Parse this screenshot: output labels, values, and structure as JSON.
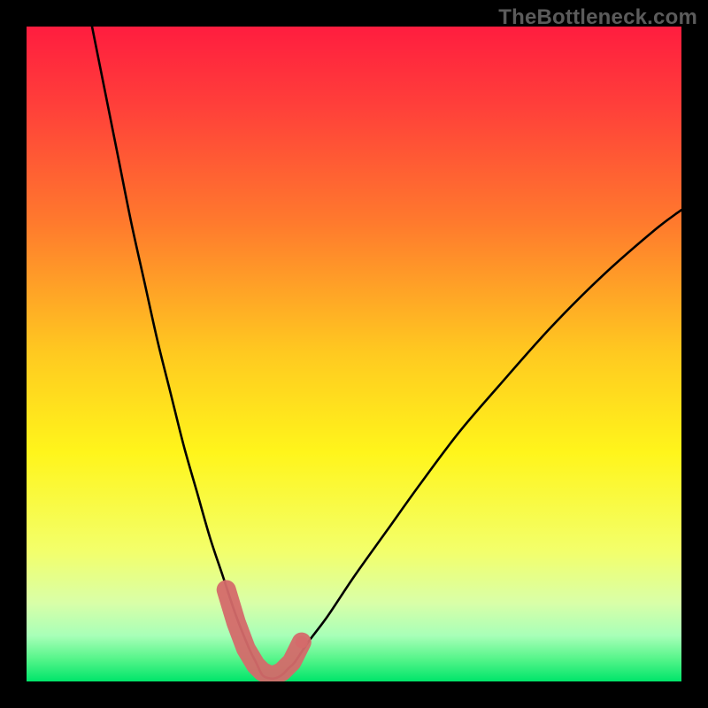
{
  "meta": {
    "watermark": "TheBottleneck.com"
  },
  "chart_data": {
    "type": "line",
    "title": "",
    "xlabel": "",
    "ylabel": "",
    "xlim": [
      0,
      100
    ],
    "ylim": [
      0,
      100
    ],
    "grid": false,
    "legend": null,
    "description": "Bottleneck % vs component balance. V-shaped curve on a red→green vertical heat gradient; minimum (~0%) occurs near x≈36.",
    "gradient_stops": [
      {
        "pos": 0.0,
        "color": "#ff1d3f"
      },
      {
        "pos": 0.12,
        "color": "#ff3f3a"
      },
      {
        "pos": 0.3,
        "color": "#ff7a2d"
      },
      {
        "pos": 0.5,
        "color": "#ffca20"
      },
      {
        "pos": 0.65,
        "color": "#fff51b"
      },
      {
        "pos": 0.8,
        "color": "#f3ff6a"
      },
      {
        "pos": 0.88,
        "color": "#d9ffa8"
      },
      {
        "pos": 0.93,
        "color": "#a8ffb8"
      },
      {
        "pos": 0.965,
        "color": "#57f58b"
      },
      {
        "pos": 1.0,
        "color": "#00e56a"
      }
    ],
    "series": [
      {
        "name": "bottleneck-curve",
        "color": "#000000",
        "x": [
          10,
          12,
          14,
          16,
          18,
          20,
          22,
          24,
          26,
          28,
          30,
          32,
          34,
          35,
          36,
          37,
          38,
          39,
          40,
          41,
          43,
          46,
          50,
          55,
          60,
          66,
          72,
          80,
          88,
          96,
          100
        ],
        "values": [
          100,
          90,
          80,
          70,
          61,
          52,
          44,
          36,
          29,
          22,
          16,
          10,
          5,
          3,
          1,
          0.5,
          0.5,
          1,
          2,
          3,
          6,
          10,
          16,
          23,
          30,
          38,
          45,
          54,
          62,
          69,
          72
        ]
      }
    ],
    "highlight": {
      "name": "optimal-range-marker",
      "color": "#d46a6a",
      "points_x": [
        30.5,
        32,
        33.5,
        35,
        36,
        37,
        38,
        39,
        40.5,
        42
      ],
      "points_y": [
        14,
        9,
        5,
        2.5,
        1.5,
        1,
        1,
        1.5,
        3,
        6
      ]
    }
  }
}
